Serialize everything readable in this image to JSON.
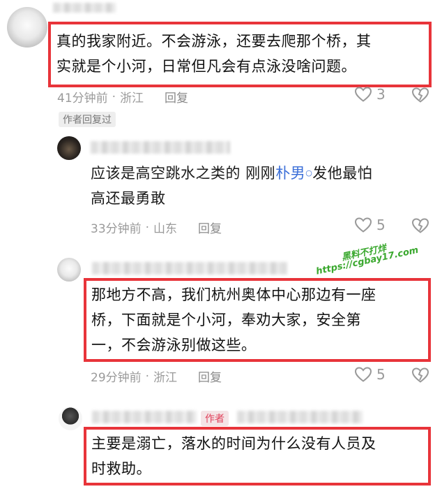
{
  "comments": [
    {
      "text_line1": "真的我家附近。不会游泳，还要去爬那个桥，其",
      "text_line2": "实就是个小河，日常但凡会有点泳没啥问题。",
      "time": "41分钟前",
      "location": "浙江",
      "reply_label": "回复",
      "likes": "3",
      "avatar_icon": "cat-avatar-icon"
    },
    {
      "text_line1_prefix": "应该是高空跳水之类的 刚刚",
      "linked_name": "朴男",
      "text_line1_suffix": "发他最怕",
      "text_line2": "高还最勇敢",
      "time": "33分钟前",
      "location": "山东",
      "reply_label": "回复",
      "likes": "5",
      "avatar_icon": "dark-avatar-icon"
    },
    {
      "text_line1": "那地方不高，我们杭州奥体中心那边有一座",
      "text_line2": "桥，下面就是个小河，奉劝大家，安全第",
      "text_line3": "一，不会游泳别做这些。",
      "time": "29分钟前",
      "location": "浙江",
      "reply_label": "回复",
      "likes": "5",
      "avatar_icon": "cat-avatar-icon"
    },
    {
      "author_badge": "作者",
      "text_line1": "主要是溺亡，落水的时间为什么没有人员及",
      "text_line2": "时救助。",
      "avatar_icon": "person-avatar-icon"
    }
  ],
  "author_replied_tag": "作者回复过",
  "meta_separator": "·",
  "watermark": {
    "line1": "黑料不打烊",
    "line2": "https://cgbay17.com"
  },
  "colors": {
    "highlight_border": "#e8343a",
    "meta_text": "#9a9a9a",
    "link_blue": "#3b6fd8",
    "watermark_green": "#3aa82e"
  }
}
